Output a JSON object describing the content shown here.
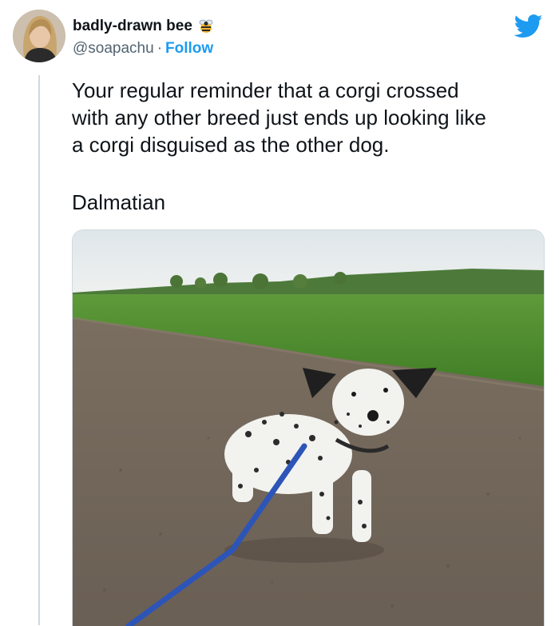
{
  "tweet": {
    "author": {
      "display_name": "badly-drawn bee",
      "handle": "@soapachu",
      "separator": "·",
      "follow_label": "Follow",
      "name_emoji_icon": "bee-icon"
    },
    "brand_icon": "twitter-bird-icon",
    "text_lines": [
      "Your regular reminder that a corgi crossed",
      "with any other breed just ends up looking like",
      "a corgi disguised as the other dog."
    ],
    "caption": "Dalmatian",
    "media": {
      "type": "photo"
    }
  },
  "colors": {
    "accent": "#1d9bf0",
    "secondary_text": "#536471",
    "thread_line": "#cfd9de"
  }
}
